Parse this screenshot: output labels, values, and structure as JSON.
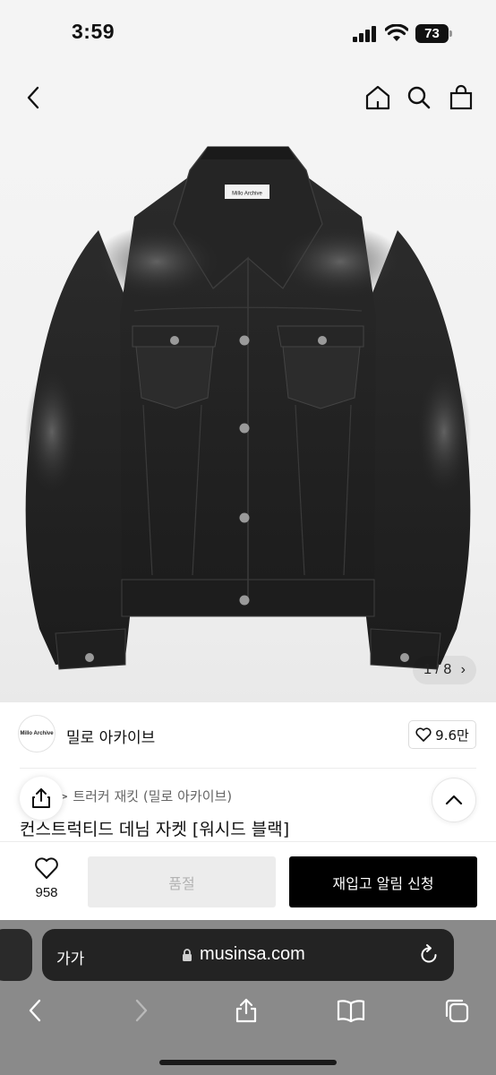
{
  "status_bar": {
    "time": "3:59",
    "battery": "73"
  },
  "product_image": {
    "counter": "1 / 8",
    "label_text": "Millo Archive"
  },
  "brand": {
    "logo_text": "Millo Archive",
    "name": "밀로 아카이브",
    "likes": "9.6만"
  },
  "product": {
    "category": "> 트러커 재킷 (밀로 아카이브)",
    "title": "컨스트럭티드 데님 자켓 [워시드 블랙]"
  },
  "action_bar": {
    "like_count": "958",
    "soldout_label": "품절",
    "notify_label": "재입고 알림 신청"
  },
  "safari": {
    "text_size_label": "가가",
    "url": "musinsa.com"
  }
}
